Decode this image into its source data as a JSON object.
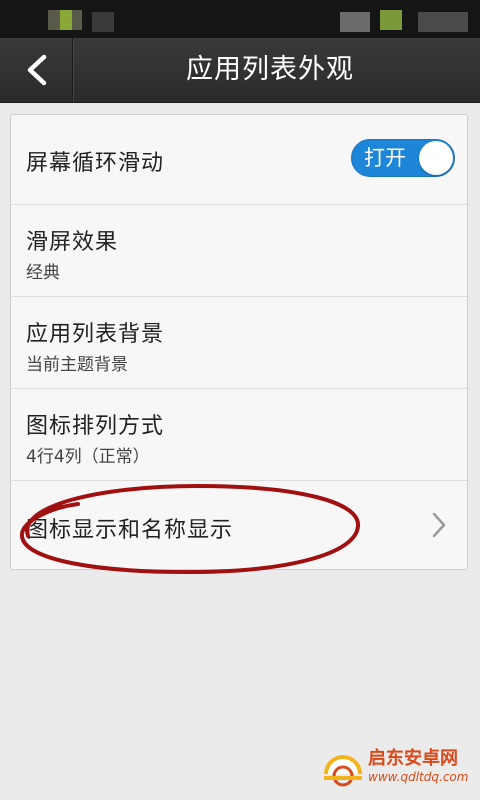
{
  "header": {
    "title": "应用列表外观"
  },
  "settings": {
    "circular_scroll": {
      "title": "屏幕循环滑动",
      "toggle_label": "打开",
      "toggle_state": "on"
    },
    "scroll_effect": {
      "title": "滑屏效果",
      "value": "经典"
    },
    "list_background": {
      "title": "应用列表背景",
      "value": "当前主题背景"
    },
    "icon_arrangement": {
      "title": "图标排列方式",
      "value": "4行4列（正常）"
    },
    "icon_and_name_display": {
      "title": "图标显示和名称显示"
    }
  },
  "watermark": {
    "text": "启东安卓网",
    "url": "www.qdltdq.com"
  },
  "colors": {
    "toggle_on": "#1e86d8",
    "annotation": "#a01010",
    "watermark": "#d84a1b"
  },
  "icons": {
    "back": "chevron-left-icon",
    "row_arrow": "chevron-right-icon"
  }
}
